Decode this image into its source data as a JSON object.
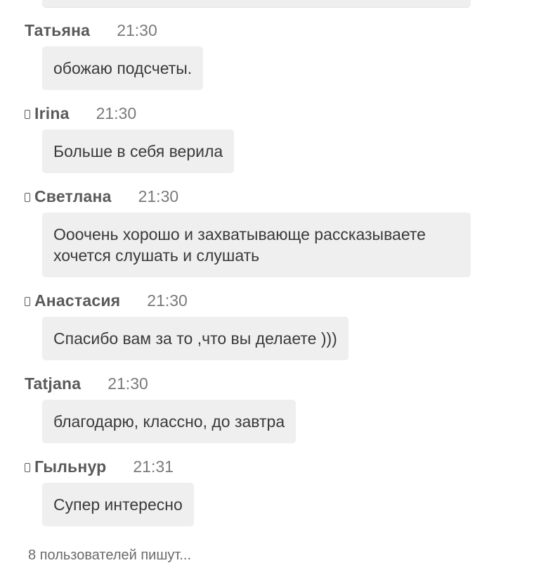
{
  "messages": [
    {
      "author": "Татьяна",
      "time": "21:30",
      "mobile": false,
      "text": "обожаю подсчеты."
    },
    {
      "author": "Irina",
      "time": "21:30",
      "mobile": true,
      "text": "Больше в себя верила"
    },
    {
      "author": "Светлана",
      "time": "21:30",
      "mobile": true,
      "text": "Ооочень хорошо и захватывающе рассказываете хочется слушать и слушать"
    },
    {
      "author": "Анастасия",
      "time": "21:30",
      "mobile": true,
      "text": "Спасибо вам за то ,что вы делаете )))"
    },
    {
      "author": "Tatjana",
      "time": "21:30",
      "mobile": false,
      "text": "благодарю, классно, до завтра"
    },
    {
      "author": "Гыльнур",
      "time": "21:31",
      "mobile": true,
      "text": "Супер интересно"
    }
  ],
  "typing_status": "8 пользователей пишут...",
  "icons": {
    "mobile": "mobile-phone-icon"
  }
}
